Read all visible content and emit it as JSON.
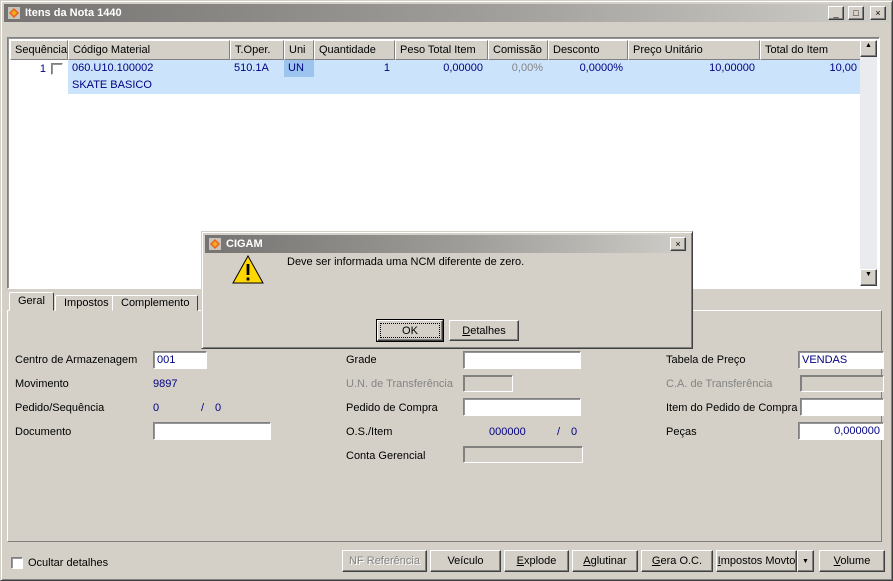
{
  "window": {
    "title": "Itens da Nota 1440"
  },
  "icons": {
    "minimize": "_",
    "maximize": "□",
    "close": "×",
    "arrow_up": "▲",
    "arrow_down": "▼",
    "dropdown": "▼"
  },
  "grid": {
    "columns": [
      "Sequência",
      "Código Material",
      "T.Oper.",
      "Uni",
      "Quantidade",
      "Peso Total Item",
      "Comissão",
      "Desconto",
      "Preço Unitário",
      "Total do Item"
    ],
    "rows": [
      {
        "seq": "1",
        "codigo": "060.U10.100002",
        "descricao": "SKATE BASICO",
        "toper": "510.1A",
        "uni": "UN",
        "quantidade": "1",
        "peso": "0,00000",
        "comissao": "0,00%",
        "desconto": "0,0000%",
        "preco": "10,00000",
        "total": "10,00"
      }
    ]
  },
  "dialog": {
    "title": "CIGAM",
    "message": "Deve ser informada uma NCM diferente de zero.",
    "ok_label": "OK",
    "detalhes_label": "Detalhes"
  },
  "tabs": [
    "Geral",
    "Impostos",
    "Complemento"
  ],
  "form": {
    "centro_armazenagem": {
      "label": "Centro de Armazenagem",
      "value": "001"
    },
    "movimento": {
      "label": "Movimento",
      "value": "9897"
    },
    "pedido_sequencia": {
      "label": "Pedido/Sequência",
      "value": "0",
      "sep": "/",
      "seq": "0"
    },
    "documento": {
      "label": "Documento",
      "value": ""
    },
    "grade": {
      "label": "Grade",
      "value": ""
    },
    "un_transferencia": {
      "label": "U.N. de Transferência",
      "value": ""
    },
    "pedido_compra": {
      "label": "Pedido de Compra",
      "value": ""
    },
    "os_item": {
      "label": "O.S./Item",
      "value": "000000",
      "sep": "/",
      "seq": "0"
    },
    "conta_gerencial": {
      "label": "Conta Gerencial",
      "value": ""
    },
    "tabela_preco": {
      "label": "Tabela de Preço",
      "value": "VENDAS"
    },
    "ca_transferencia": {
      "label": "C.A. de Transferência",
      "value": ""
    },
    "item_pedido_compra": {
      "label": "Item do Pedido de Compra",
      "value": ""
    },
    "pecas": {
      "label": "Peças",
      "value": "0,000000"
    }
  },
  "footer": {
    "ocultar_label": "Ocultar detalhes",
    "buttons": [
      "NF Referência",
      "Veículo",
      "Explode",
      "Aglutinar",
      "Gera O.C.",
      "Impostos Movto",
      "Volume"
    ]
  }
}
